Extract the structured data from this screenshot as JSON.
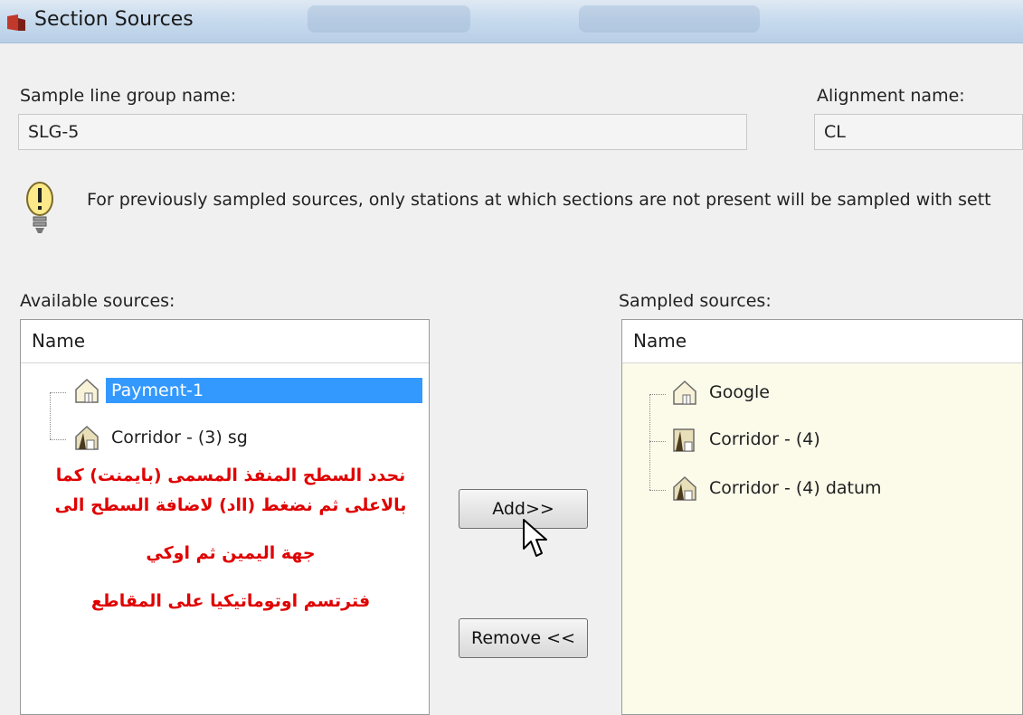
{
  "window": {
    "title": "Section Sources"
  },
  "sample_line_group": {
    "label": "Sample line group name:",
    "value": "SLG-5"
  },
  "alignment": {
    "label": "Alignment name:",
    "value": "CL"
  },
  "info": {
    "text": "For previously sampled sources, only stations at which sections are not present will be sampled with sett"
  },
  "available": {
    "label": "Available sources:",
    "column": "Name",
    "items": [
      {
        "label": "Payment-1",
        "icon": "surface-icon",
        "selected": true
      },
      {
        "label": "Corridor - (3) sg",
        "icon": "corridor-surface-icon",
        "selected": false
      }
    ]
  },
  "sampled": {
    "label": "Sampled sources:",
    "column": "Name",
    "items": [
      {
        "label": "Google",
        "icon": "surface-icon"
      },
      {
        "label": "Corridor - (4)",
        "icon": "corridor-icon"
      },
      {
        "label": "Corridor - (4) datum",
        "icon": "corridor-surface-icon"
      }
    ]
  },
  "buttons": {
    "add": "Add>>",
    "remove": "Remove <<"
  },
  "annotation": {
    "line1": "نحدد السطح المنفذ المسمى (بايمنت) كما",
    "line2": "بالاعلى ثم نضغط (ااد) لاضافة السطح الى",
    "line3": "جهة اليمين ثم اوكي",
    "line4": "فترتسم اوتوماتيكيا على المقاطع"
  },
  "colors": {
    "selection": "#3399ff",
    "annotation": "#e00000",
    "sampled_bg": "#fcfbea"
  }
}
